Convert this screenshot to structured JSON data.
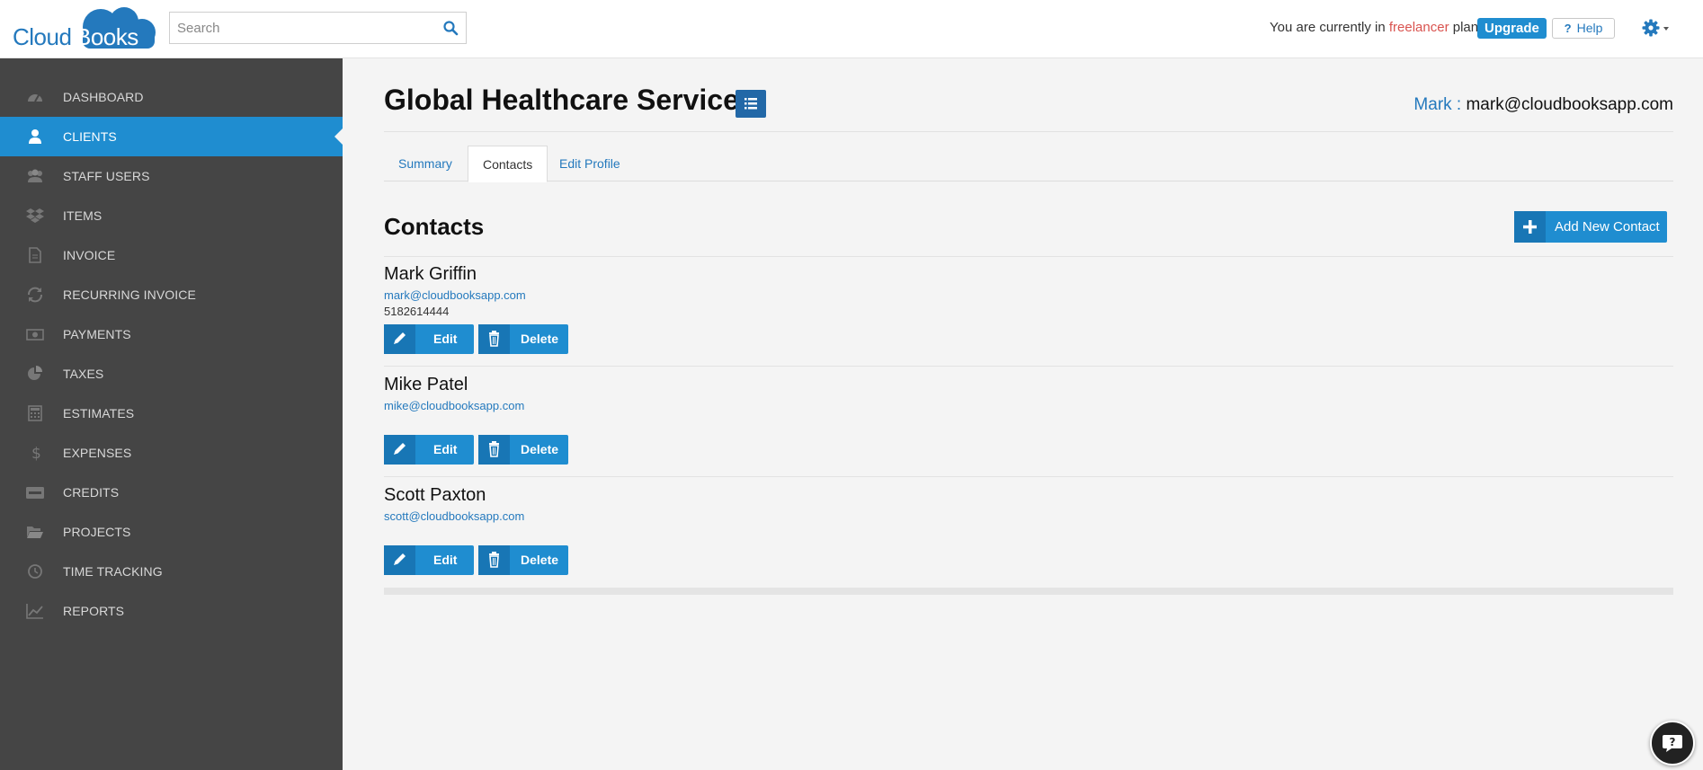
{
  "brand": {
    "logo_part1": "Cloud",
    "logo_part2": "Books",
    "accent": "#1f8dd0"
  },
  "header": {
    "search_placeholder": "Search",
    "plan_prefix": "You are currently in",
    "plan_name": "freelancer",
    "plan_suffix": "plan.",
    "upgrade_label": "Upgrade",
    "help_label": "Help"
  },
  "sidebar": {
    "items": [
      {
        "label": "DASHBOARD",
        "icon": "dashboard-icon"
      },
      {
        "label": "CLIENTS",
        "icon": "user-icon",
        "active": true
      },
      {
        "label": "STAFF USERS",
        "icon": "users-icon"
      },
      {
        "label": "ITEMS",
        "icon": "dropbox-icon"
      },
      {
        "label": "INVOICE",
        "icon": "file-icon"
      },
      {
        "label": "RECURRING INVOICE",
        "icon": "refresh-icon"
      },
      {
        "label": "PAYMENTS",
        "icon": "money-icon"
      },
      {
        "label": "TAXES",
        "icon": "pie-chart-icon"
      },
      {
        "label": "ESTIMATES",
        "icon": "calculator-icon"
      },
      {
        "label": "EXPENSES",
        "icon": "dollar-icon"
      },
      {
        "label": "CREDITS",
        "icon": "credit-card-icon"
      },
      {
        "label": "PROJECTS",
        "icon": "folder-open-icon"
      },
      {
        "label": "TIME TRACKING",
        "icon": "clock-icon"
      },
      {
        "label": "REPORTS",
        "icon": "line-chart-icon"
      }
    ]
  },
  "main": {
    "title": "Global Healthcare Services",
    "user_name": "Mark :",
    "user_email": "mark@cloudbooksapp.com",
    "tabs": [
      {
        "label": "Summary"
      },
      {
        "label": "Contacts",
        "active": true
      },
      {
        "label": "Edit Profile"
      }
    ],
    "section_title": "Contacts",
    "add_contact_label": "Add New Contact",
    "edit_label": "Edit",
    "delete_label": "Delete",
    "contacts": [
      {
        "name": "Mark Griffin",
        "email": "mark@cloudbooksapp.com",
        "phone": "5182614444"
      },
      {
        "name": "Mike Patel",
        "email": "mike@cloudbooksapp.com",
        "phone": ""
      },
      {
        "name": "Scott Paxton",
        "email": "scott@cloudbooksapp.com",
        "phone": ""
      }
    ]
  }
}
